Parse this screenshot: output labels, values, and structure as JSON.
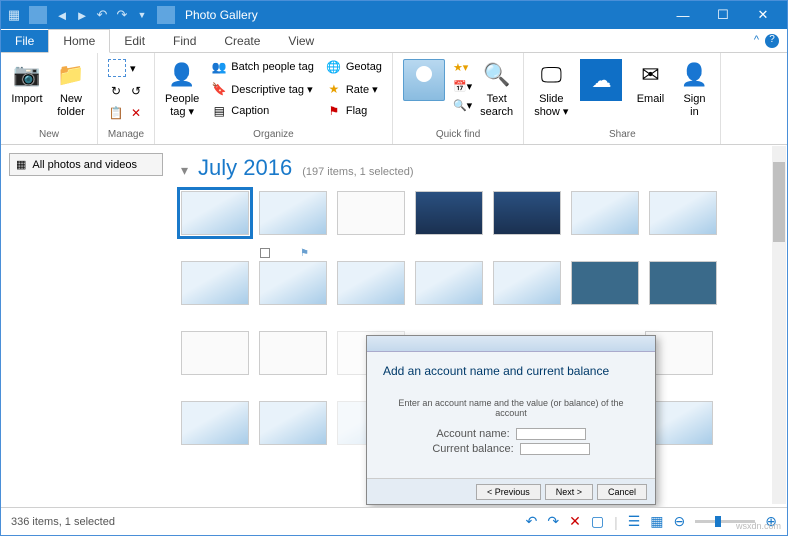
{
  "titlebar": {
    "title": "Photo Gallery"
  },
  "tabs": {
    "file": "File",
    "home": "Home",
    "edit": "Edit",
    "find": "Find",
    "create": "Create",
    "view": "View"
  },
  "ribbon": {
    "import": "Import",
    "newfolder": "New\nfolder",
    "new_group": "New",
    "manage": "Manage",
    "peopletag": "People\ntag ▾",
    "batch": "Batch people tag",
    "geotag": "Geotag",
    "descriptive": "Descriptive tag ▾",
    "rate": "Rate ▾",
    "caption": "Caption",
    "flag": "Flag",
    "organize": "Organize",
    "textsearch": "Text\nsearch",
    "quickfind": "Quick find",
    "slideshow": "Slide\nshow ▾",
    "email": "Email",
    "signin": "Sign\nin",
    "share": "Share"
  },
  "sidebar": {
    "nav": "All photos and videos"
  },
  "header": {
    "date": "July 2016",
    "count": "(197 items, 1 selected)"
  },
  "preview": {
    "title": "Add an account name and current balance",
    "hint": "Enter an account name and the value (or balance) of the account",
    "lbl1": "Account name:",
    "lbl2": "Current balance:",
    "back": "< Previous",
    "next": "Next >",
    "cancel": "Cancel"
  },
  "status": {
    "text": "336 items, 1 selected"
  },
  "watermark": "wsxdn.com"
}
